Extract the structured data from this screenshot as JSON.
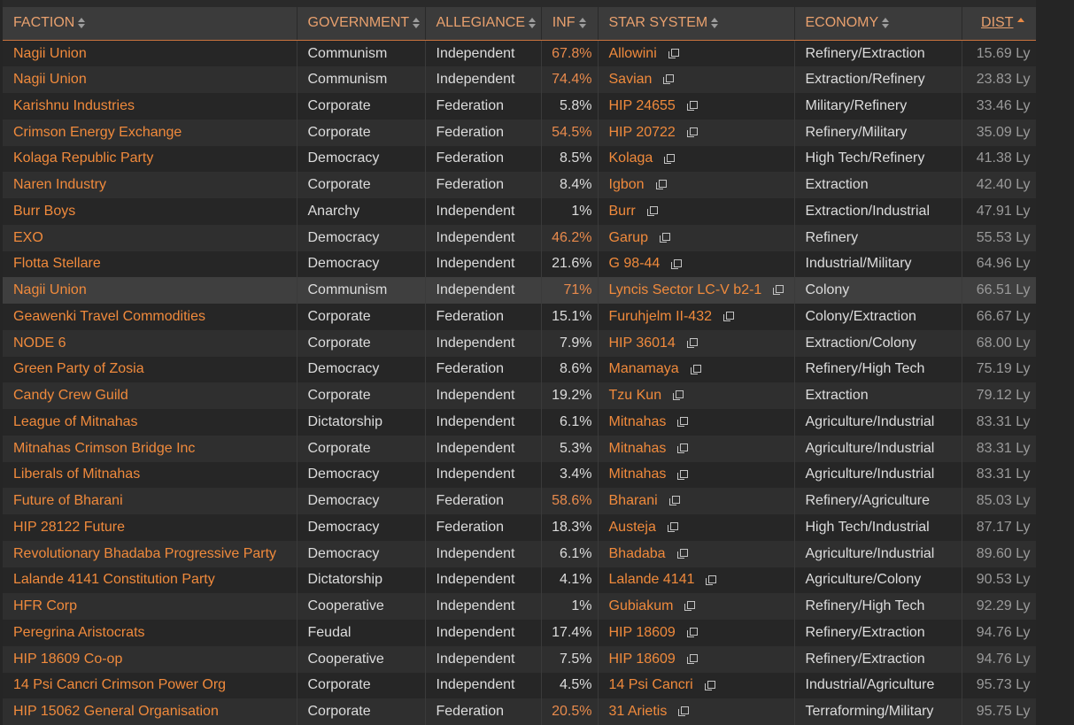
{
  "headers": {
    "faction": "FACTION",
    "government": "GOVERNMENT",
    "allegiance": "ALLEGIANCE",
    "inf": "INF",
    "star_system": "STAR SYSTEM",
    "economy": "ECONOMY",
    "dist": "DIST"
  },
  "sort": {
    "column": "dist",
    "direction": "ascending"
  },
  "icons": {
    "sort": "sort-icon",
    "external_link": "external-link-icon"
  },
  "colors": {
    "accent": "#f08a3c",
    "background": "#262626",
    "header": "#3b3b3b"
  },
  "highlighted_row": 9,
  "rows": [
    {
      "faction": "Nagii Union",
      "government": "Communism",
      "allegiance": "Independent",
      "inf": "67.8%",
      "inf_high": true,
      "star_system": "Allowini",
      "economy": "Refinery/Extraction",
      "dist": "15.69 Ly"
    },
    {
      "faction": "Nagii Union",
      "government": "Communism",
      "allegiance": "Independent",
      "inf": "74.4%",
      "inf_high": true,
      "star_system": "Savian",
      "economy": "Extraction/Refinery",
      "dist": "23.83 Ly"
    },
    {
      "faction": "Karishnu Industries",
      "government": "Corporate",
      "allegiance": "Federation",
      "inf": "5.8%",
      "inf_high": false,
      "star_system": "HIP 24655",
      "economy": "Military/Refinery",
      "dist": "33.46 Ly"
    },
    {
      "faction": "Crimson Energy Exchange",
      "government": "Corporate",
      "allegiance": "Federation",
      "inf": "54.5%",
      "inf_high": true,
      "star_system": "HIP 20722",
      "economy": "Refinery/Military",
      "dist": "35.09 Ly"
    },
    {
      "faction": "Kolaga Republic Party",
      "government": "Democracy",
      "allegiance": "Federation",
      "inf": "8.5%",
      "inf_high": false,
      "star_system": "Kolaga",
      "economy": "High Tech/Refinery",
      "dist": "41.38 Ly"
    },
    {
      "faction": "Naren Industry",
      "government": "Corporate",
      "allegiance": "Federation",
      "inf": "8.4%",
      "inf_high": false,
      "star_system": "Igbon",
      "economy": "Extraction",
      "dist": "42.40 Ly"
    },
    {
      "faction": "Burr Boys",
      "government": "Anarchy",
      "allegiance": "Independent",
      "inf": "1%",
      "inf_high": false,
      "star_system": "Burr",
      "economy": "Extraction/Industrial",
      "dist": "47.91 Ly"
    },
    {
      "faction": "EXO",
      "government": "Democracy",
      "allegiance": "Independent",
      "inf": "46.2%",
      "inf_high": true,
      "star_system": "Garup",
      "economy": "Refinery",
      "dist": "55.53 Ly"
    },
    {
      "faction": "Flotta Stellare",
      "government": "Democracy",
      "allegiance": "Independent",
      "inf": "21.6%",
      "inf_high": false,
      "star_system": "G 98-44",
      "economy": "Industrial/Military",
      "dist": "64.96 Ly"
    },
    {
      "faction": "Nagii Union",
      "government": "Communism",
      "allegiance": "Independent",
      "inf": "71%",
      "inf_high": true,
      "star_system": "Lyncis Sector LC-V b2-1",
      "economy": "Colony",
      "dist": "66.51 Ly"
    },
    {
      "faction": "Geawenki Travel Commodities",
      "government": "Corporate",
      "allegiance": "Federation",
      "inf": "15.1%",
      "inf_high": false,
      "star_system": "Furuhjelm II-432",
      "economy": "Colony/Extraction",
      "dist": "66.67 Ly"
    },
    {
      "faction": "NODE 6",
      "government": "Corporate",
      "allegiance": "Independent",
      "inf": "7.9%",
      "inf_high": false,
      "star_system": "HIP 36014",
      "economy": "Extraction/Colony",
      "dist": "68.00 Ly"
    },
    {
      "faction": "Green Party of Zosia",
      "government": "Democracy",
      "allegiance": "Federation",
      "inf": "8.6%",
      "inf_high": false,
      "star_system": "Manamaya",
      "economy": "Refinery/High Tech",
      "dist": "75.19 Ly"
    },
    {
      "faction": "Candy Crew Guild",
      "government": "Corporate",
      "allegiance": "Independent",
      "inf": "19.2%",
      "inf_high": false,
      "star_system": "Tzu Kun",
      "economy": "Extraction",
      "dist": "79.12 Ly"
    },
    {
      "faction": "League of Mitnahas",
      "government": "Dictatorship",
      "allegiance": "Independent",
      "inf": "6.1%",
      "inf_high": false,
      "star_system": "Mitnahas",
      "economy": "Agriculture/Industrial",
      "dist": "83.31 Ly"
    },
    {
      "faction": "Mitnahas Crimson Bridge Inc",
      "government": "Corporate",
      "allegiance": "Independent",
      "inf": "5.3%",
      "inf_high": false,
      "star_system": "Mitnahas",
      "economy": "Agriculture/Industrial",
      "dist": "83.31 Ly"
    },
    {
      "faction": "Liberals of Mitnahas",
      "government": "Democracy",
      "allegiance": "Independent",
      "inf": "3.4%",
      "inf_high": false,
      "star_system": "Mitnahas",
      "economy": "Agriculture/Industrial",
      "dist": "83.31 Ly"
    },
    {
      "faction": "Future of Bharani",
      "government": "Democracy",
      "allegiance": "Federation",
      "inf": "58.6%",
      "inf_high": true,
      "star_system": "Bharani",
      "economy": "Refinery/Agriculture",
      "dist": "85.03 Ly"
    },
    {
      "faction": "HIP 28122 Future",
      "government": "Democracy",
      "allegiance": "Federation",
      "inf": "18.3%",
      "inf_high": false,
      "star_system": "Austeja",
      "economy": "High Tech/Industrial",
      "dist": "87.17 Ly"
    },
    {
      "faction": "Revolutionary Bhadaba Progressive Party",
      "government": "Democracy",
      "allegiance": "Independent",
      "inf": "6.1%",
      "inf_high": false,
      "star_system": "Bhadaba",
      "economy": "Agriculture/Industrial",
      "dist": "89.60 Ly"
    },
    {
      "faction": "Lalande 4141 Constitution Party",
      "government": "Dictatorship",
      "allegiance": "Independent",
      "inf": "4.1%",
      "inf_high": false,
      "star_system": "Lalande 4141",
      "economy": "Agriculture/Colony",
      "dist": "90.53 Ly"
    },
    {
      "faction": "HFR Corp",
      "government": "Cooperative",
      "allegiance": "Independent",
      "inf": "1%",
      "inf_high": false,
      "star_system": "Gubiakum",
      "economy": "Refinery/High Tech",
      "dist": "92.29 Ly"
    },
    {
      "faction": "Peregrina Aristocrats",
      "government": "Feudal",
      "allegiance": "Independent",
      "inf": "17.4%",
      "inf_high": false,
      "star_system": "HIP 18609",
      "economy": "Refinery/Extraction",
      "dist": "94.76 Ly"
    },
    {
      "faction": "HIP 18609 Co-op",
      "government": "Cooperative",
      "allegiance": "Independent",
      "inf": "7.5%",
      "inf_high": false,
      "star_system": "HIP 18609",
      "economy": "Refinery/Extraction",
      "dist": "94.76 Ly"
    },
    {
      "faction": "14 Psi Cancri Crimson Power Org",
      "government": "Corporate",
      "allegiance": "Independent",
      "inf": "4.5%",
      "inf_high": false,
      "star_system": "14 Psi Cancri",
      "economy": "Industrial/Agriculture",
      "dist": "95.73 Ly"
    },
    {
      "faction": "HIP 15062 General Organisation",
      "government": "Corporate",
      "allegiance": "Federation",
      "inf": "20.5%",
      "inf_high": true,
      "star_system": "31 Arietis",
      "economy": "Terraforming/Military",
      "dist": "95.75 Ly"
    }
  ]
}
